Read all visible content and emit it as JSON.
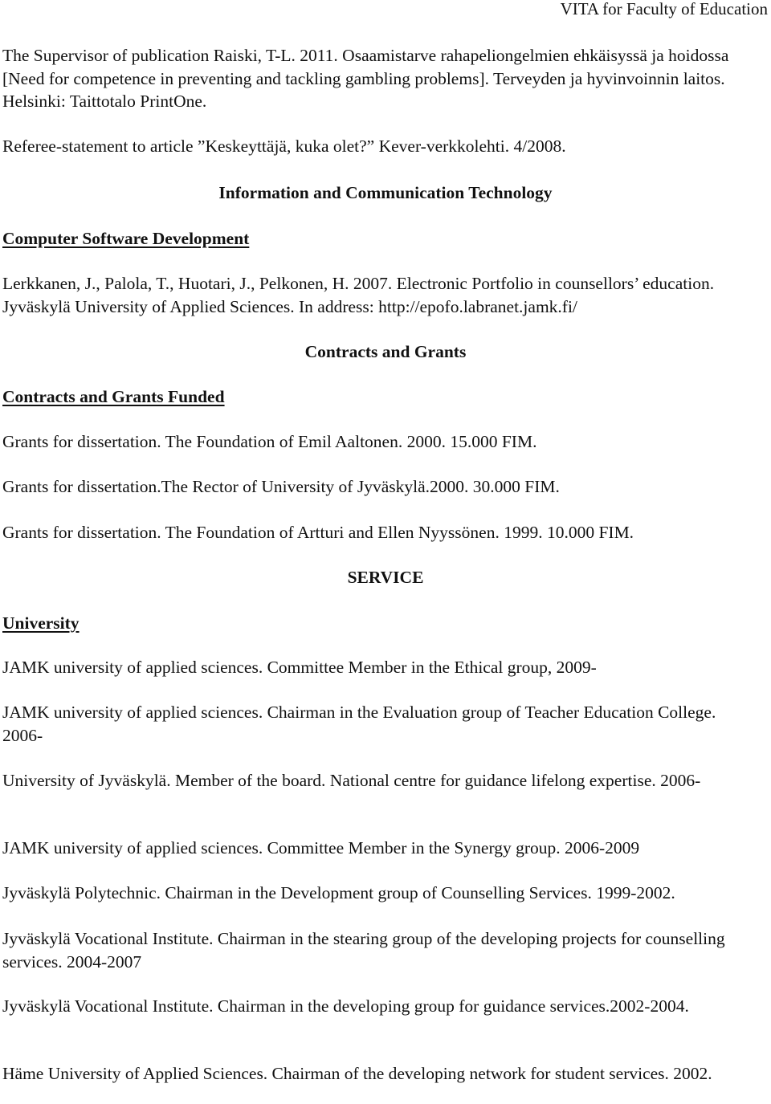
{
  "header": {
    "running_title": "VITA for Faculty of Education"
  },
  "publications": [
    "The Supervisor of publication Raiski, T-L. 2011. Osaamistarve rahapeliongelmien ehkäisyssä ja hoidossa [Need for competence in preventing and tackling gambling problems]. Terveyden ja hyvinvoinnin laitos. Helsinki: Taittotalo PrintOne.",
    "Referee-statement to article ”Keskeyttäjä, kuka olet?” Kever-verkkolehti. 4/2008."
  ],
  "ict_section": {
    "heading": "Information and Communication Technology",
    "subheading": "Computer Software Development",
    "entries": [
      "Lerkkanen, J., Palola, T., Huotari, J., Pelkonen, H. 2007. Electronic Portfolio in counsellors’ education. Jyväskylä University of Applied Sciences. In address: http://epofo.labranet.jamk.fi/"
    ]
  },
  "contracts_section": {
    "heading": "Contracts and Grants",
    "subheading": "Contracts and Grants Funded",
    "entries": [
      "Grants for dissertation. The Foundation of Emil Aaltonen. 2000. 15.000 FIM.",
      "Grants for dissertation.The Rector of  University of Jyväskylä.2000. 30.000 FIM.",
      "Grants for dissertation. The Foundation of Artturi and Ellen Nyyssönen. 1999. 10.000 FIM."
    ]
  },
  "service_section": {
    "heading": "SERVICE",
    "subheading": "University",
    "entries": [
      "JAMK university of applied sciences. Committee Member in the Ethical group, 2009-",
      "JAMK university of applied sciences. Chairman in the Evaluation group of Teacher Education College. 2006-",
      "University of Jyväskylä. Member of the board. National centre for guidance lifelong expertise. 2006-",
      "JAMK university of applied sciences. Committee Member in the Synergy group. 2006-2009",
      "Jyväskylä Polytechnic. Chairman in the Development group of Counselling Services. 1999-2002.",
      "Jyväskylä Vocational Institute. Chairman in the stearing group of the developing projects for counselling services. 2004-2007",
      "Jyväskylä Vocational Institute. Chairman in the developing group for guidance services.2002-2004.",
      "Häme University of Applied Sciences. Chairman of the developing network for student services. 2002."
    ]
  }
}
